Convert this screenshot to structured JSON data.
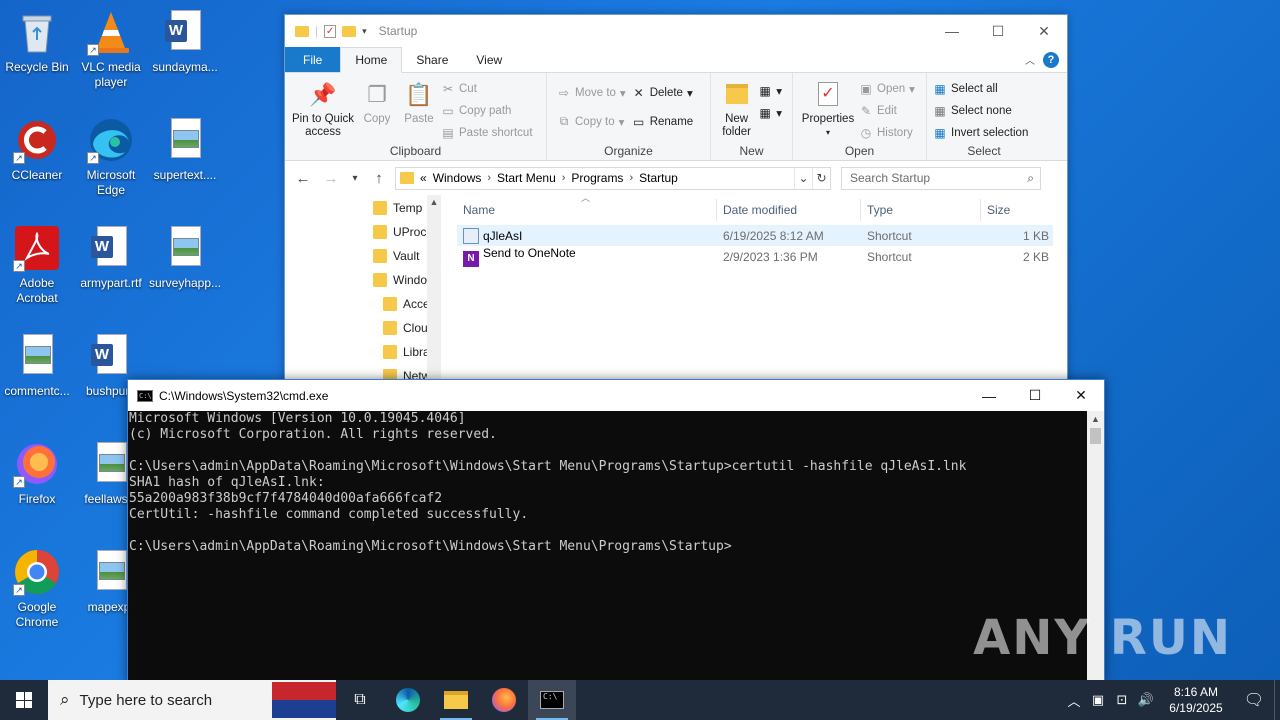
{
  "desktop": {
    "icons": [
      {
        "label": "Recycle Bin"
      },
      {
        "label": "VLC media player"
      },
      {
        "label": "sundayma..."
      },
      {
        "label": "CCleaner"
      },
      {
        "label": "Microsoft Edge"
      },
      {
        "label": "supertext...."
      },
      {
        "label": "Adobe Acrobat"
      },
      {
        "label": "armypart.rtf"
      },
      {
        "label": "surveyhapp..."
      },
      {
        "label": "commentc..."
      },
      {
        "label": "bushpurp"
      },
      {
        "label": "Firefox"
      },
      {
        "label": "feellaws.p"
      },
      {
        "label": "Google Chrome"
      },
      {
        "label": "mapexpr"
      }
    ]
  },
  "explorer": {
    "title": "Startup",
    "tabs": {
      "file": "File",
      "home": "Home",
      "share": "Share",
      "view": "View"
    },
    "ribbon": {
      "clipboard": {
        "group": "Clipboard",
        "pin": "Pin to Quick access",
        "copy": "Copy",
        "paste": "Paste",
        "cut": "Cut",
        "copy_path": "Copy path",
        "paste_shortcut": "Paste shortcut"
      },
      "organize": {
        "group": "Organize",
        "move_to": "Move to",
        "copy_to": "Copy to",
        "delete": "Delete",
        "rename": "Rename"
      },
      "new": {
        "group": "New",
        "new_folder": "New folder"
      },
      "open": {
        "group": "Open",
        "properties": "Properties",
        "open": "Open",
        "edit": "Edit",
        "history": "History"
      },
      "select": {
        "group": "Select",
        "select_all": "Select all",
        "select_none": "Select none",
        "invert": "Invert selection"
      }
    },
    "address": {
      "prefix": "«",
      "crumbs": [
        "Windows",
        "Start Menu",
        "Programs",
        "Startup"
      ]
    },
    "search_placeholder": "Search Startup",
    "nav_items": [
      "Temp",
      "UProc",
      "Vault",
      "Windo",
      "Acce",
      "Clou",
      "Libra",
      "Netw"
    ],
    "columns": {
      "name": "Name",
      "date": "Date modified",
      "type": "Type",
      "size": "Size"
    },
    "files": [
      {
        "name": "qJleAsI",
        "date": "6/19/2025 8:12 AM",
        "type": "Shortcut",
        "size": "1 KB"
      },
      {
        "name": "Send to OneNote",
        "date": "2/9/2023 1:36 PM",
        "type": "Shortcut",
        "size": "2 KB"
      }
    ]
  },
  "cmd": {
    "title": "C:\\Windows\\System32\\cmd.exe",
    "lines": [
      "Microsoft Windows [Version 10.0.19045.4046]",
      "(c) Microsoft Corporation. All rights reserved.",
      "",
      "C:\\Users\\admin\\AppData\\Roaming\\Microsoft\\Windows\\Start Menu\\Programs\\Startup>certutil -hashfile qJleAsI.lnk",
      "SHA1 hash of qJleAsI.lnk:",
      "55a200a983f38b9cf7f4784040d00afa666fcaf2",
      "CertUtil: -hashfile command completed successfully.",
      "",
      "C:\\Users\\admin\\AppData\\Roaming\\Microsoft\\Windows\\Start Menu\\Programs\\Startup>"
    ]
  },
  "watermark": "ANY RUN",
  "taskbar": {
    "search_placeholder": "Type here to search",
    "time": "8:16 AM",
    "date": "6/19/2025"
  }
}
